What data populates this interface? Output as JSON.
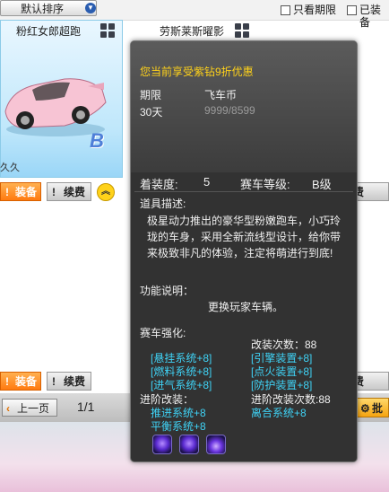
{
  "toolbar": {
    "sort_label": "默认排序",
    "only_expiring_label": "只看期限",
    "equipped_label": "已装备"
  },
  "card1": {
    "title": "粉红女郎超跑",
    "badge": "B",
    "duration_text": "久久",
    "equip_label": "装备",
    "renew_label": "续费"
  },
  "card2": {
    "title": "劳斯莱斯曜影"
  },
  "row2": {
    "equip_label": "装备",
    "renew_label": "续费",
    "right_renew_label": "费"
  },
  "row1_right": {
    "renew_label": "费"
  },
  "bottom": {
    "prev_label": "上一页",
    "page_text": "1/1",
    "right_button_label": "批"
  },
  "tooltip": {
    "promo": "您当前享受紫钻9折优惠",
    "col_period": "期限",
    "col_price": "飞车币",
    "period_value": "30天",
    "price_value": "9999/8599",
    "equip_degree_label": "着装度:",
    "equip_degree_value": "5",
    "car_level_label": "赛车等级:",
    "car_level_value": "B级",
    "item_desc_label": "道具描述:",
    "item_desc": "极星动力推出的豪华型粉嫩跑车，小巧玲珑的车身，采用全新流线型设计，给你带来极致非凡的体验，注定将萌进行到底!",
    "func_label": "功能说明：",
    "func_text": "更换玩家车辆。",
    "enhance_label": "赛车强化:",
    "modify_count": "改装次数：88",
    "enhance_items": [
      "[悬挂系统+8]",
      "[引擎装置+8]",
      "[燃料系统+8]",
      "[点火装置+8]",
      "[进气系统+8]",
      "[防护装置+8]"
    ],
    "advanced_label": "进阶改装：",
    "advanced_count": "进阶改装次数:88",
    "advanced_items": [
      "推进系统+8",
      "离合系统+8",
      "平衡系统+8"
    ],
    "skill_icons": [
      "purple-orb-skill-icon",
      "purple-orb-skill-icon",
      "purple-crystal-skill-icon"
    ]
  },
  "colors": {
    "promo_yellow": "#ffd21a",
    "enhance_blue": "#3fd3f6",
    "advanced_green": "#70e04a",
    "equip_orange": "#ff8a1a",
    "badge_blue": "#4f7fd8"
  }
}
